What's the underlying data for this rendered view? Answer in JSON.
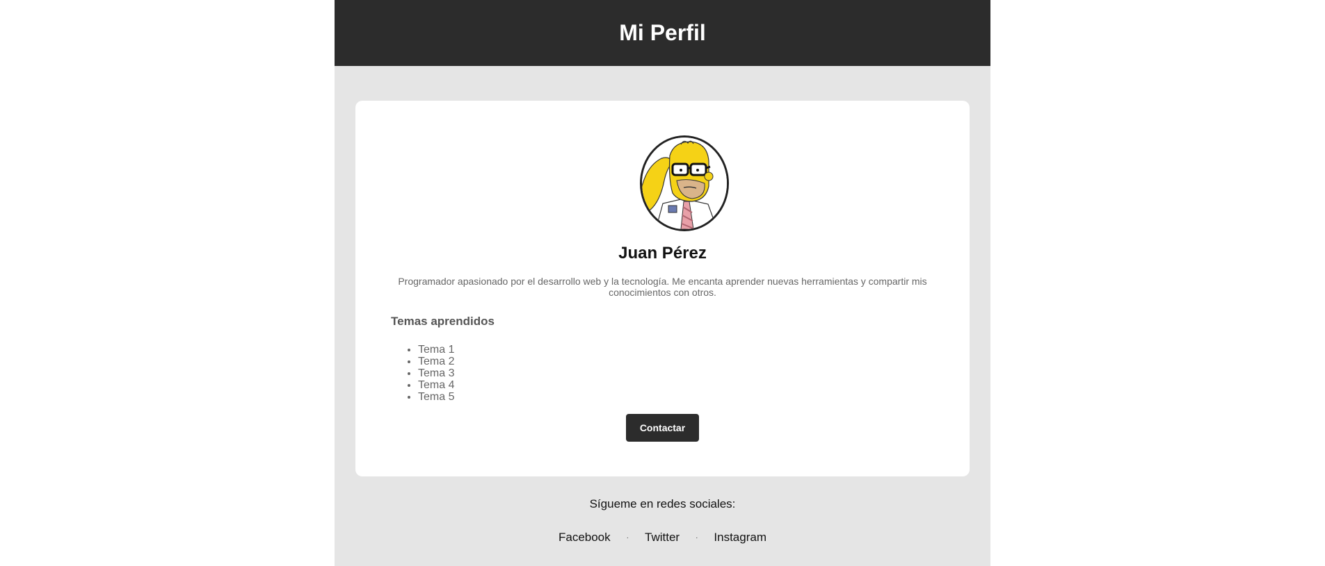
{
  "header": {
    "title": "Mi Perfil"
  },
  "profile": {
    "name": "Juan Pérez",
    "bio": "Programador apasionado por el desarrollo web y la tecnología. Me encanta aprender nuevas herramientas y compartir mis conocimientos con otros.",
    "avatar_icon": "cartoon-avatar-icon",
    "topics_title": "Temas aprendidos",
    "topics": [
      "Tema 1",
      "Tema 2",
      "Tema 3",
      "Tema 4",
      "Tema 5"
    ],
    "contact_label": "Contactar"
  },
  "footer": {
    "title": "Sígueme en redes sociales:",
    "separator": "·",
    "links": [
      "Facebook",
      "Twitter",
      "Instagram"
    ]
  },
  "colors": {
    "header_bg": "#2c2c2c",
    "page_bg": "#e5e5e5",
    "card_bg": "#ffffff",
    "avatar_skin": "#f5d216"
  }
}
